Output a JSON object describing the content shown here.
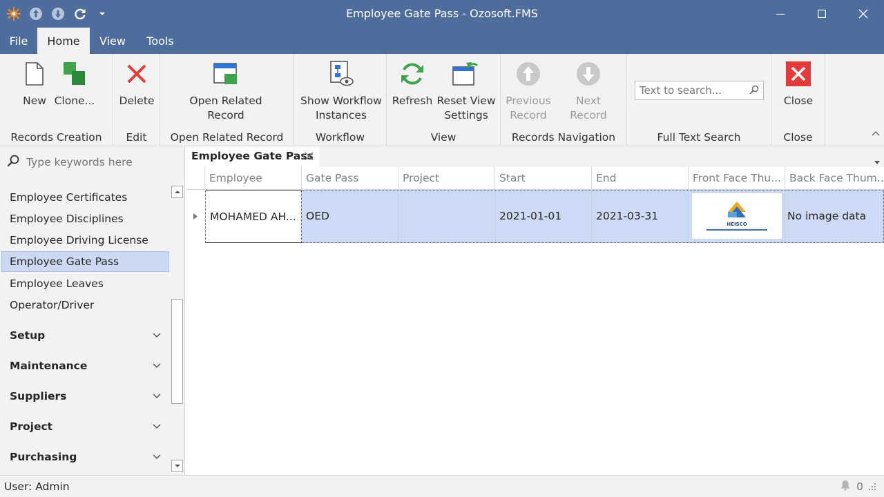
{
  "window": {
    "title": "Employee Gate Pass - Ozosoft.FMS"
  },
  "menu": {
    "tabs": [
      "File",
      "Home",
      "View",
      "Tools"
    ],
    "active": "Home"
  },
  "ribbon": {
    "groups": {
      "records_creation": "Records Creation",
      "edit": "Edit",
      "open_related": "Open Related Record",
      "workflow": "Workflow",
      "view": "View",
      "navigation": "Records Navigation",
      "search": "Full Text Search",
      "close": "Close"
    },
    "buttons": {
      "new": "New",
      "clone": "Clone...",
      "delete": "Delete",
      "open_related": "Open Related\nRecord",
      "show_workflow": "Show Workflow\nInstances",
      "refresh": "Refresh",
      "reset_view": "Reset View\nSettings",
      "previous": "Previous\nRecord",
      "next": "Next Record",
      "close": "Close"
    },
    "search_placeholder": "Text to search..."
  },
  "nav": {
    "search_placeholder": "Type keywords here",
    "items": [
      "Employee Certificates",
      "Employee Disciplines",
      "Employee Driving License",
      "Employee Gate Pass",
      "Employee Leaves",
      "Operator/Driver"
    ],
    "selected": "Employee Gate Pass",
    "groups": [
      "Setup",
      "Maintenance",
      "Suppliers",
      "Project",
      "Purchasing"
    ]
  },
  "document": {
    "tab": "Employee Gate Pass"
  },
  "grid": {
    "columns": [
      "Employee",
      "Gate Pass",
      "Project",
      "Start",
      "End",
      "Front Face Thu...",
      "Back Face Thum..."
    ],
    "rows": [
      {
        "employee": "MOHAMED AH...",
        "gate_pass": "OED",
        "project": "",
        "start": "2021-01-01",
        "end": "2021-03-31",
        "front_face": "image",
        "back_face": "No image data"
      }
    ],
    "thumb_logo_text": "HEISCO"
  },
  "status": {
    "user": "User: Admin",
    "notifications": "0"
  },
  "colors": {
    "titlebar": "#4e6c9c",
    "ribbon": "#f2f2f2",
    "selection": "#ccdaf5",
    "accent_green": "#3fa34d",
    "accent_red": "#e81123",
    "accent_blue": "#2e75d6"
  }
}
